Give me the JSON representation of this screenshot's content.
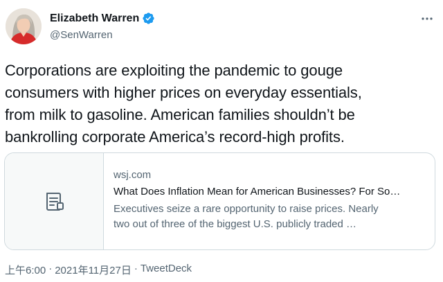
{
  "author": {
    "display_name": "Elizabeth Warren",
    "handle": "@SenWarren",
    "verified": true
  },
  "tweet": {
    "text": "Corporations are exploiting the pandemic to gouge\nconsumers with higher prices on everyday essentials,\nfrom milk to gasoline. American families shouldn’t be\nbankrolling corporate America’s record-high profits."
  },
  "card": {
    "domain": "wsj.com",
    "title": "What Does Inflation Mean for American Businesses? For So…",
    "description": "Executives seize a rare opportunity to raise prices. Nearly\ntwo out of three of the biggest U.S. publicly traded …",
    "icon": "document-icon"
  },
  "meta": {
    "time": "上午6:00",
    "separator": "·",
    "date": "2021年11月27日",
    "separator2": "·",
    "source": "TweetDeck"
  },
  "colors": {
    "verified_badge": "#1d9bf0",
    "secondary_text": "#536471",
    "border": "#cfd9de"
  },
  "icons": {
    "more": "more-horizontal-icon",
    "verified": "verified-badge-icon"
  }
}
